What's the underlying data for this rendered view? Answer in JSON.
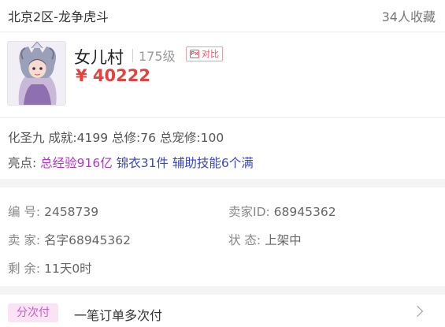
{
  "header": {
    "server": "北京2区-龙争虎斗",
    "favorites": "34人收藏"
  },
  "role": {
    "name": "女儿村",
    "level": "175级",
    "compare_label": "对比",
    "compare_icon": "Px",
    "price": "¥ 40222"
  },
  "attributes": "化圣九 成就:4199 总修:76 总宠修:100",
  "highlights": {
    "label": "亮点:",
    "items": [
      "总经验916亿",
      "锦衣31件",
      "辅助技能6个满"
    ]
  },
  "info": {
    "id_label": "编 号:",
    "id_value": "2458739",
    "seller_id_label": "卖家ID:",
    "seller_id_value": "68945362",
    "seller_label": "卖 家:",
    "seller_value": "名字68945362",
    "status_label": "状 态:",
    "status_value": "上架中",
    "remaining_label": "剩 余:",
    "remaining_value": "11天0时"
  },
  "payment": {
    "tag": "分次付",
    "text": "一笔订单多次付"
  },
  "colors": {
    "price": "#e5413e",
    "highlight_purple": "#b432c8",
    "highlight_blue": "#3a46c9",
    "pay_tag_bg": "#f9e3f5"
  }
}
